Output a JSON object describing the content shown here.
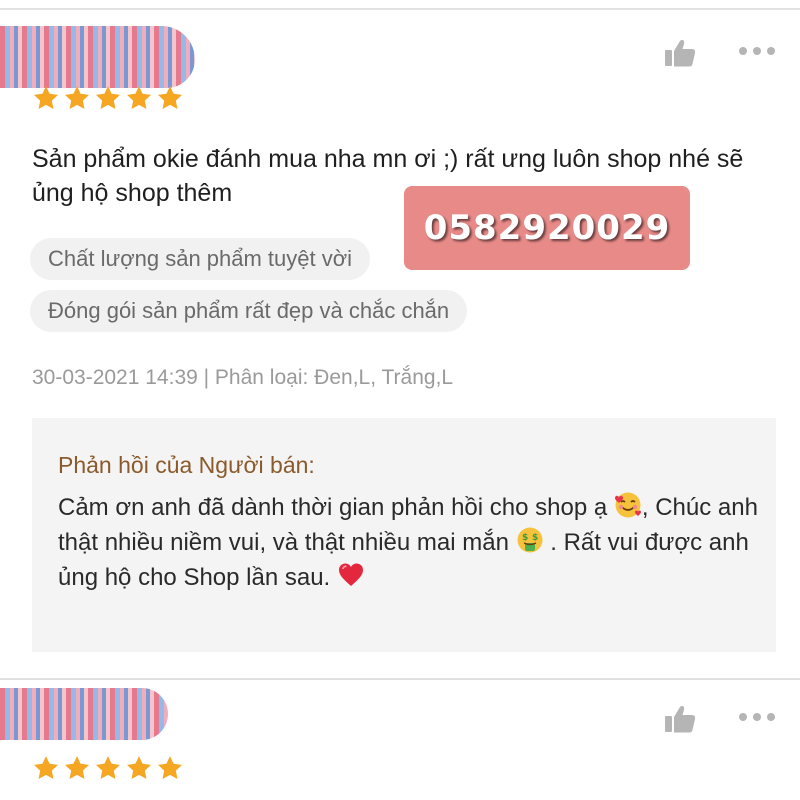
{
  "reviews": [
    {
      "rating": 5,
      "text": "Sản phẩm okie đánh mua nha mn ơi ;) rất ưng luôn shop nhé sẽ ủng hộ shop thêm",
      "tags": [
        "Chất lượng sản phẩm tuyệt vời",
        "Đóng gói sản phẩm rất đẹp và chắc chắn"
      ],
      "meta": "30-03-2021 14:39 | Phân loại: Đen,L, Trắng,L",
      "seller_reply": {
        "title": "Phản hồi của Người bán:",
        "part1": "Cảm ơn anh đã dành thời gian phản hồi cho shop ạ ",
        "part2": ", Chúc anh thật nhiều niềm vui, và thật nhiều mai mắn ",
        "part3": " . Rất vui được anh ủng hộ cho Shop lần sau. ",
        "emojis": [
          "smiling-face-with-hearts-icon",
          "money-mouth-face-icon",
          "red-heart-icon"
        ]
      }
    },
    {
      "rating": 5
    }
  ],
  "overlay": {
    "phone": "0582920029",
    "color": "#e88a88"
  },
  "colors": {
    "star": "#f5a623",
    "reply_title": "#8b5a2b",
    "tag_bg": "#f1f1f1",
    "reply_bg": "#f4f4f4"
  },
  "icons": {
    "like": "thumbs-up-icon",
    "more": "more-dots-icon",
    "star": "star-icon"
  }
}
